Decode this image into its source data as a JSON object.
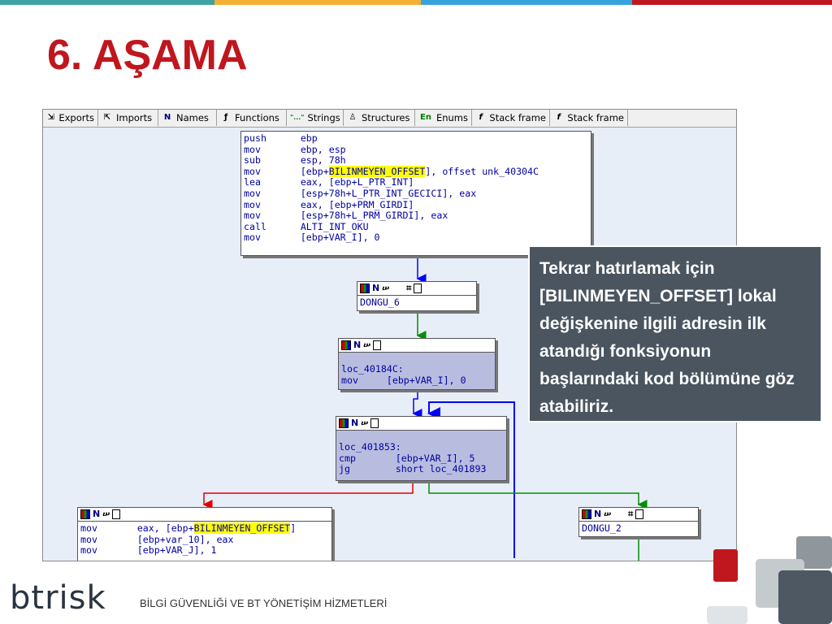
{
  "slide": {
    "title": "6. AŞAMA",
    "topbar_colors": [
      "#3fa2a4",
      "#f2b134",
      "#35a4dc",
      "#c0161e"
    ]
  },
  "ida": {
    "tabs": [
      {
        "icon": "exports-icon",
        "label": "Exports"
      },
      {
        "icon": "imports-icon",
        "label": "Imports"
      },
      {
        "icon": "names-icon",
        "label": "Names"
      },
      {
        "icon": "functions-icon",
        "label": "Functions"
      },
      {
        "icon": "strings-icon",
        "label": "Strings"
      },
      {
        "icon": "structures-icon",
        "label": "Structures"
      },
      {
        "icon": "enums-icon",
        "label": "Enums"
      },
      {
        "icon": "stack-frame-icon",
        "label": "Stack frame"
      },
      {
        "icon": "stack-frame-icon",
        "label": "Stack frame"
      }
    ],
    "tab_icon_text": [
      "",
      "",
      "N",
      "",
      "\"...\"",
      "",
      "En",
      "f",
      "f"
    ],
    "nodes": {
      "prologue": {
        "lines": [
          [
            "push",
            "ebp"
          ],
          [
            "mov",
            "ebp, esp"
          ],
          [
            "sub",
            "esp, 78h"
          ],
          [
            "mov",
            "[ebp+BILINMEYEN_OFFSET], offset unk_40304C"
          ],
          [
            "lea",
            "eax, [ebp+L_PTR_INT]"
          ],
          [
            "mov",
            "[esp+78h+L_PTR_INT_GECICI], eax"
          ],
          [
            "mov",
            "eax, [ebp+PRM_GIRDI]"
          ],
          [
            "mov",
            "[esp+78h+L_PRM_GIRDI], eax"
          ],
          [
            "call",
            "ALTI_INT_OKU"
          ],
          [
            "mov",
            "[ebp+VAR_I], 0"
          ]
        ]
      },
      "dongu6": {
        "label": "DONGU_6"
      },
      "loc40184c": {
        "label": "loc_40184C:",
        "mnem": "mov",
        "op": "[ebp+VAR_I], 0"
      },
      "loc401853": {
        "label": "loc_401853:",
        "lines": [
          [
            "cmp",
            "[ebp+VAR_I], 5"
          ],
          [
            "jg",
            "short loc_401893"
          ]
        ]
      },
      "left": {
        "lines": [
          [
            "mov",
            "eax, [ebp+BILINMEYEN_OFFSET]"
          ],
          [
            "mov",
            "[ebp+var_10], eax"
          ],
          [
            "mov",
            "[ebp+VAR_J], 1"
          ]
        ]
      },
      "dongu2": {
        "label": "DONGU_2"
      }
    },
    "edge_colors": {
      "normal": "#0000ff",
      "true": "#009000",
      "false": "#e00000"
    }
  },
  "callout": {
    "text": "Tekrar hatırlamak için [BILINMEYEN_OFFSET] lokal değişkenine ilgili adresin ilk atandığı fonksiyonun başlarındaki kod bölümüne göz atabiliriz."
  },
  "footer": {
    "logo": "btrisk",
    "tagline": "BİLGİ GÜVENLİĞİ VE BT YÖNETİŞİM HİZMETLERİ"
  }
}
